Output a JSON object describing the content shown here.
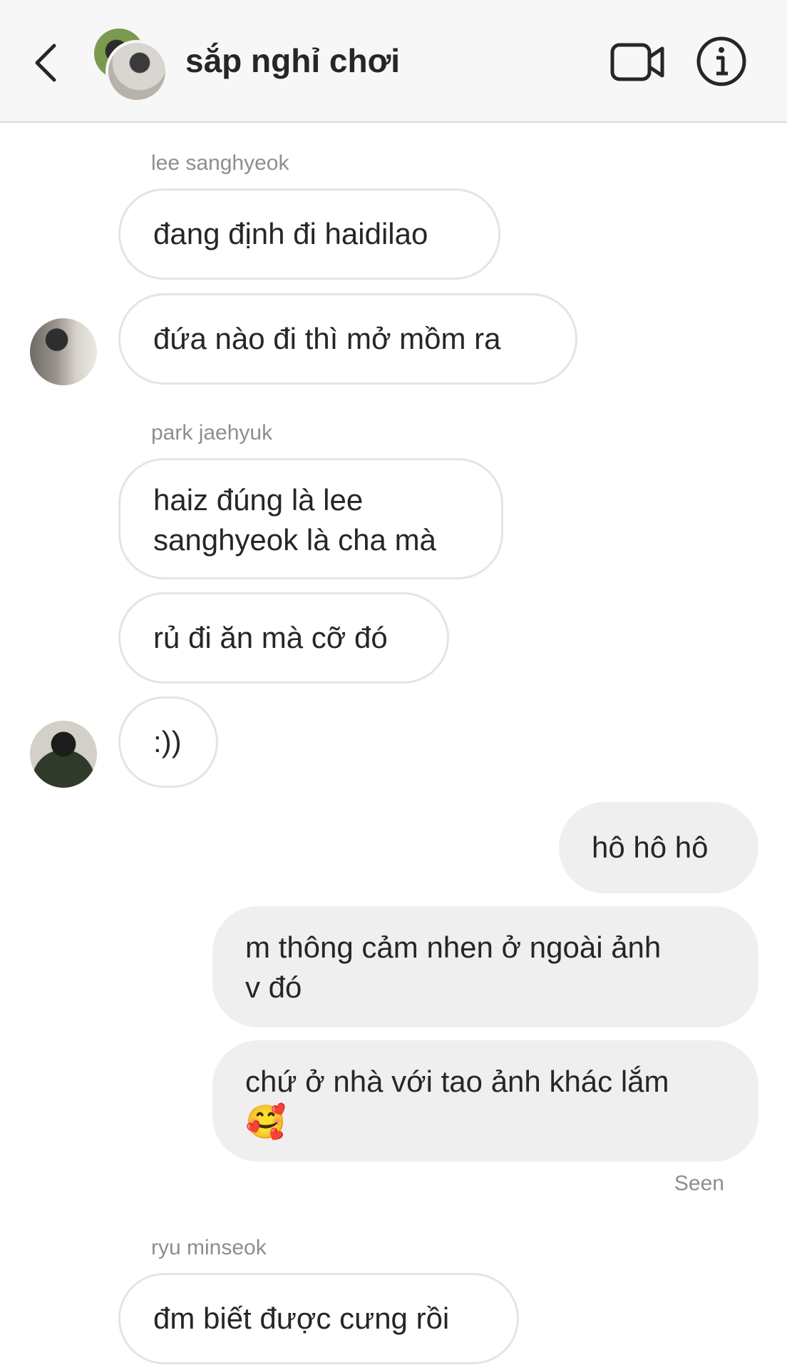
{
  "header": {
    "title": "sắp nghỉ chơi",
    "back_icon": "chevron-left-icon",
    "video_icon": "video-camera-icon",
    "info_icon": "info-icon"
  },
  "messages": [
    {
      "sender": "lee sanghyeok",
      "texts": [
        "đang định đi haidilao",
        "đứa nào đi thì mở mồm ra"
      ]
    },
    {
      "sender": "park jaehyuk",
      "texts": [
        "haiz đúng là lee",
        "sanghyeok là cha mà",
        "rủ đi ăn mà cỡ đó",
        ":))"
      ]
    },
    {
      "sender": "me",
      "texts": [
        "hô hô hô",
        "m thông cảm nhen ở ngoài ảnh",
        "v đó",
        "chứ ở nhà với tao ảnh khác lắm",
        "🥰"
      ]
    },
    {
      "sender": "ryu minseok",
      "texts": [
        "đm biết được cưng rồi"
      ]
    }
  ],
  "status": {
    "seen": "Seen"
  },
  "colors": {
    "header_bg": "#f7f7f7",
    "incoming_border": "#e4e4e4",
    "outgoing_bg": "#efefef",
    "muted_text": "#8e8e8e"
  }
}
